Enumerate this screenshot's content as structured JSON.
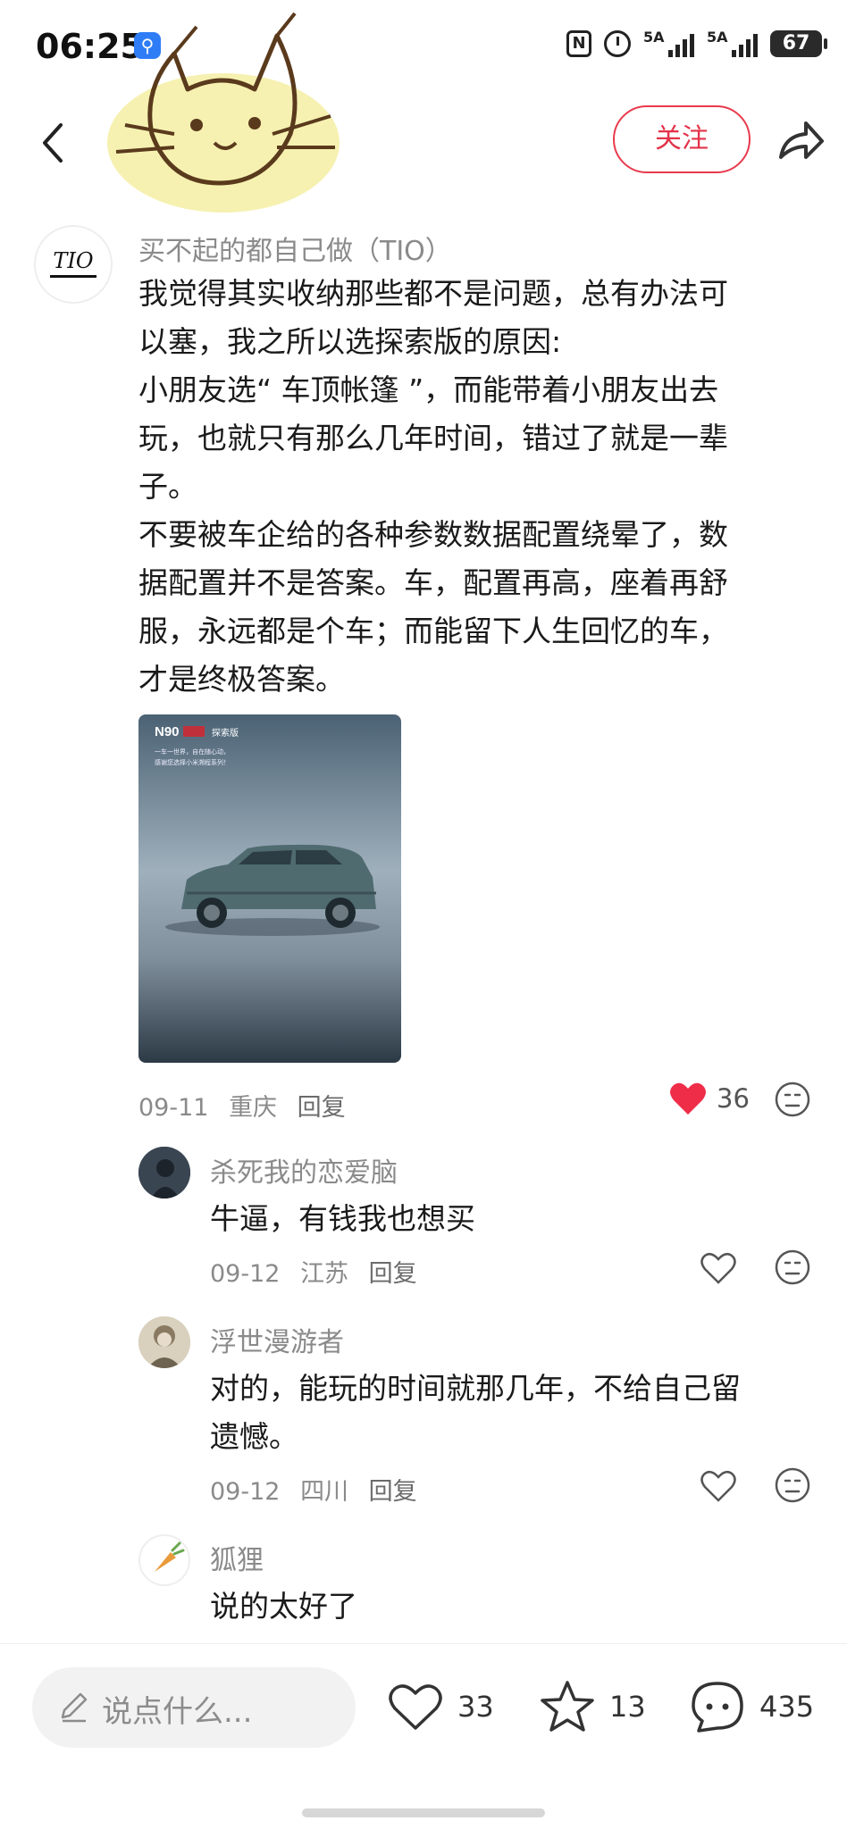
{
  "status_bar": {
    "time": "06:25",
    "signal1_label": "5A",
    "signal2_label": "5A",
    "battery": "67"
  },
  "header": {
    "follow_label": "关注"
  },
  "main_comment": {
    "username": "买不起的都自己做（TIO）",
    "avatar_text": "TIO",
    "lines": [
      "我觉得其实收纳那些都不是问题，总有办法可",
      "以塞，我之所以选探索版的原因:",
      "小朋友选“ 车顶帐篷 ”，而能带着小朋友出去",
      "玩，也就只有那么几年时间，错过了就是一辈",
      "子。",
      "不要被车企给的各种参数数据配置绕晕了，数",
      "据配置并不是答案。车，配置再高，座着再舒",
      "服，永远都是个车；而能留下人生回忆的车，",
      "才是终极答案。"
    ],
    "image": {
      "model": "N90",
      "edition": "探索版",
      "tagline1": "一车一世界，自在随心动，",
      "tagline2": "感谢您选择小米溯程系列！"
    },
    "date": "09-11",
    "location": "重庆",
    "reply_label": "回复",
    "likes": "36",
    "liked": true
  },
  "replies": [
    {
      "username": "杀死我的恋爱脑",
      "lines": [
        "牛逼，有钱我也想买"
      ],
      "date": "09-12",
      "location": "江苏",
      "reply_label": "回复"
    },
    {
      "username": "浮世漫游者",
      "lines": [
        "对的，能玩的时间就那几年，不给自己留",
        "遗憾。"
      ],
      "date": "09-12",
      "location": "四川",
      "reply_label": "回复"
    },
    {
      "username": "狐狸",
      "lines": [
        "说的太好了"
      ]
    }
  ],
  "bottom_bar": {
    "input_placeholder": "说点什么...",
    "likes": "33",
    "favorites": "13",
    "comments": "435"
  },
  "colors": {
    "accent": "#e2334a",
    "like_red": "#ef2d48",
    "meta_gray": "#8a8a8a"
  }
}
